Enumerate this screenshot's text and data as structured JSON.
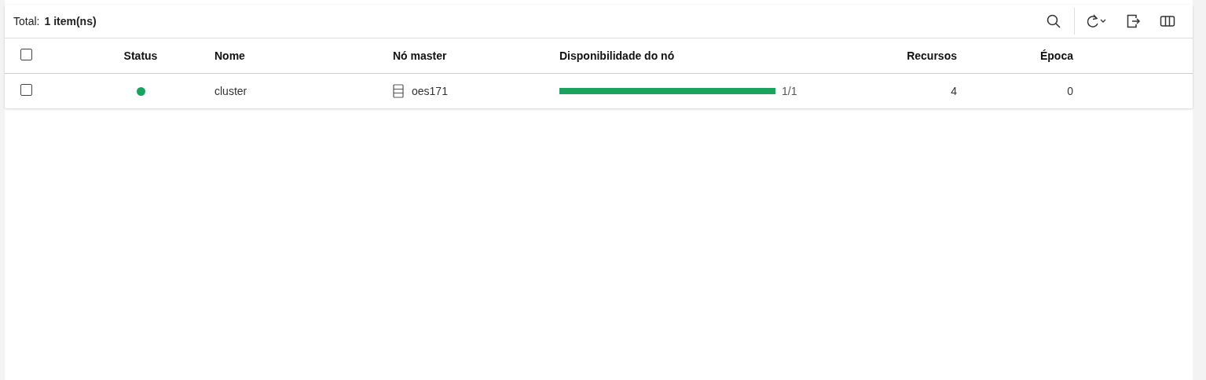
{
  "toolbar": {
    "total_label": "Total:",
    "total_value": "1 item(ns)"
  },
  "table": {
    "select_all": {
      "checked": false
    },
    "columns": [
      "Status",
      "Nome",
      "Nó master",
      "Disponibilidade do nó",
      "Recursos",
      "Época"
    ],
    "rows": [
      {
        "checked": false,
        "color": "#1aa35f",
        "name": "cluster",
        "master": "oes171",
        "availability": {
          "level": 1,
          "reading": "1/1"
        },
        "resources": "4",
        "epoch": "0"
      }
    ]
  }
}
